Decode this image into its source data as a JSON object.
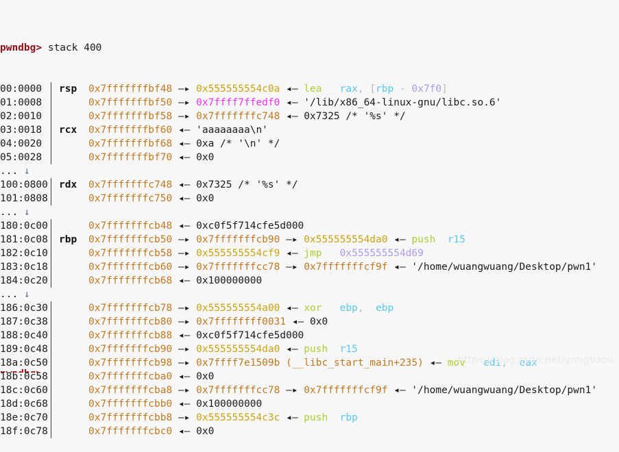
{
  "terminal": {
    "prompt": "pwndbg>",
    "command": "stack 400",
    "watermark": "https://blog.csdn.net/yongbaoii",
    "colors": {
      "background": "#f7f7f7",
      "prompt": "#8b0f18",
      "stack_address": "#c07820",
      "code_address": "#c8a415",
      "libc_address": "#ee33ee",
      "mnemonic": "#a8cf35",
      "register_operand": "#58c8e8",
      "immediate": "#b09ae8",
      "text": "#1a1a1a"
    },
    "arrows": {
      "deref": "—▸",
      "value": "◂—",
      "down": "↓"
    },
    "ellipsis": "...",
    "rows": [
      {
        "index": "00:0000",
        "reg": "rsp",
        "addr": "0x7fffffffbf48",
        "addr_kind": "stack",
        "arrow": "deref",
        "parts": [
          {
            "t": "0x555555554c0a",
            "c": "codeaddr"
          },
          {
            "t": "◂—",
            "c": "arrow"
          },
          {
            "t": "lea",
            "c": "mnemonic"
          },
          {
            "t": "rax",
            "c": "regop"
          },
          {
            "t": ",",
            "c": "punct"
          },
          {
            "t": "[",
            "c": "punct"
          },
          {
            "t": "rbp",
            "c": "regop"
          },
          {
            "t": "-",
            "c": "punct"
          },
          {
            "t": "0x7f0",
            "c": "imm"
          },
          {
            "t": "]",
            "c": "punct"
          }
        ]
      },
      {
        "index": "01:0008",
        "reg": "",
        "addr": "0x7fffffffbf50",
        "addr_kind": "stack",
        "arrow": "deref",
        "parts": [
          {
            "t": "0x7ffff7ffedf0",
            "c": "libcaddr"
          },
          {
            "t": "◂—",
            "c": "arrow"
          },
          {
            "t": "'/lib/x86_64-linux-gnu/libc.so.6'",
            "c": "plain"
          }
        ]
      },
      {
        "index": "02:0010",
        "reg": "",
        "addr": "0x7fffffffbf58",
        "addr_kind": "stack",
        "arrow": "deref",
        "parts": [
          {
            "t": "0x7fffffffc748",
            "c": "stackaddr"
          },
          {
            "t": "◂—",
            "c": "arrow"
          },
          {
            "t": "0x7325 /* '%s' */",
            "c": "plain"
          }
        ]
      },
      {
        "index": "03:0018",
        "reg": "rcx",
        "addr": "0x7fffffffbf60",
        "addr_kind": "stack",
        "arrow": "value",
        "parts": [
          {
            "t": "'aaaaaaaa\\n'",
            "c": "plain"
          }
        ]
      },
      {
        "index": "04:0020",
        "reg": "",
        "addr": "0x7fffffffbf68",
        "addr_kind": "stack",
        "arrow": "value",
        "parts": [
          {
            "t": "0xa /* '\\n' */",
            "c": "plain"
          }
        ]
      },
      {
        "index": "05:0028",
        "reg": "",
        "addr": "0x7fffffffbf70",
        "addr_kind": "stack",
        "arrow": "value",
        "parts": [
          {
            "t": "0x0",
            "c": "plain"
          }
        ]
      },
      {
        "index": "",
        "separator": true
      },
      {
        "index": "100:0800",
        "reg": "rdx",
        "addr": "0x7fffffffc748",
        "addr_kind": "stack",
        "arrow": "value",
        "parts": [
          {
            "t": "0x7325 /* '%s' */",
            "c": "plain"
          }
        ]
      },
      {
        "index": "101:0808",
        "reg": "",
        "addr": "0x7fffffffc750",
        "addr_kind": "stack",
        "arrow": "value",
        "parts": [
          {
            "t": "0x0",
            "c": "plain"
          }
        ]
      },
      {
        "index": "",
        "separator": true
      },
      {
        "index": "180:0c00",
        "reg": "",
        "addr": "0x7fffffffcb48",
        "addr_kind": "stack",
        "arrow": "value",
        "parts": [
          {
            "t": "0xc0f5f714cfe5d000",
            "c": "plain"
          }
        ]
      },
      {
        "index": "181:0c08",
        "reg": "rbp",
        "addr": "0x7fffffffcb50",
        "addr_kind": "stack",
        "arrow": "deref",
        "parts": [
          {
            "t": "0x7fffffffcb90",
            "c": "stackaddr"
          },
          {
            "t": "—▸",
            "c": "arrow"
          },
          {
            "t": "0x555555554da0",
            "c": "codeaddr"
          },
          {
            "t": "◂—",
            "c": "arrow"
          },
          {
            "t": "push",
            "c": "mnemonic"
          },
          {
            "t": "r15",
            "c": "regop"
          }
        ]
      },
      {
        "index": "182:0c10",
        "reg": "",
        "addr": "0x7fffffffcb58",
        "addr_kind": "stack",
        "arrow": "deref",
        "parts": [
          {
            "t": "0x555555554cf9",
            "c": "codeaddr"
          },
          {
            "t": "◂—",
            "c": "arrow"
          },
          {
            "t": "jmp",
            "c": "mnemonic"
          },
          {
            "t": "0x555555554d69",
            "c": "imm"
          }
        ]
      },
      {
        "index": "183:0c18",
        "reg": "",
        "addr": "0x7fffffffcb60",
        "addr_kind": "stack",
        "arrow": "deref",
        "parts": [
          {
            "t": "0x7fffffffcc78",
            "c": "stackaddr"
          },
          {
            "t": "—▸",
            "c": "arrow"
          },
          {
            "t": "0x7fffffffcf9f",
            "c": "stackaddr"
          },
          {
            "t": "◂—",
            "c": "arrow"
          },
          {
            "t": "'/home/wuangwuang/Desktop/pwn1'",
            "c": "plain"
          }
        ]
      },
      {
        "index": "184:0c20",
        "reg": "",
        "addr": "0x7fffffffcb68",
        "addr_kind": "stack",
        "arrow": "value",
        "parts": [
          {
            "t": "0x100000000",
            "c": "plain"
          }
        ]
      },
      {
        "index": "",
        "separator": true
      },
      {
        "index": "186:0c30",
        "reg": "",
        "addr": "0x7fffffffcb78",
        "addr_kind": "stack",
        "arrow": "deref",
        "parts": [
          {
            "t": "0x555555554a00",
            "c": "codeaddr"
          },
          {
            "t": "◂—",
            "c": "arrow"
          },
          {
            "t": "xor",
            "c": "mnemonic"
          },
          {
            "t": "ebp",
            "c": "regop"
          },
          {
            "t": ",",
            "c": "punct"
          },
          {
            "t": "ebp",
            "c": "regop"
          }
        ]
      },
      {
        "index": "187:0c38",
        "reg": "",
        "addr": "0x7fffffffcb80",
        "addr_kind": "stack",
        "arrow": "deref",
        "parts": [
          {
            "t": "0x7ffffffff0031",
            "c": "stackaddr"
          },
          {
            "t": "◂—",
            "c": "arrow"
          },
          {
            "t": "0x0",
            "c": "plain"
          }
        ]
      },
      {
        "index": "188:0c40",
        "reg": "",
        "addr": "0x7fffffffcb88",
        "addr_kind": "stack",
        "arrow": "value",
        "parts": [
          {
            "t": "0xc0f5f714cfe5d000",
            "c": "plain"
          }
        ]
      },
      {
        "index": "189:0c48",
        "reg": "",
        "addr": "0x7fffffffcb90",
        "addr_kind": "stack",
        "arrow": "deref",
        "parts": [
          {
            "t": "0x555555554da0",
            "c": "codeaddr"
          },
          {
            "t": "◂—",
            "c": "arrow"
          },
          {
            "t": "push",
            "c": "mnemonic"
          },
          {
            "t": "r15",
            "c": "regop"
          }
        ]
      },
      {
        "index": "18a:0c50",
        "reg": "",
        "addr": "0x7fffffffcb98",
        "addr_kind": "stack",
        "arrow": "deref",
        "parts": [
          {
            "t": "0x7ffff7e1509b",
            "c": "stackaddr"
          },
          {
            "t": "(__libc_start_main+235)",
            "c": "symbol"
          },
          {
            "t": "◂—",
            "c": "arrow"
          },
          {
            "t": "mov",
            "c": "mnemonic"
          },
          {
            "t": "edi",
            "c": "regop"
          },
          {
            "t": ",",
            "c": "punct"
          },
          {
            "t": "eax",
            "c": "regop"
          }
        ]
      },
      {
        "index": "18b:0c58",
        "reg": "",
        "addr": "0x7fffffffcba0",
        "addr_kind": "stack",
        "arrow": "value",
        "parts": [
          {
            "t": "0x0",
            "c": "plain"
          }
        ]
      },
      {
        "index": "18c:0c60",
        "reg": "",
        "addr": "0x7fffffffcba8",
        "addr_kind": "stack",
        "arrow": "deref",
        "parts": [
          {
            "t": "0x7fffffffcc78",
            "c": "stackaddr"
          },
          {
            "t": "—▸",
            "c": "arrow"
          },
          {
            "t": "0x7fffffffcf9f",
            "c": "stackaddr"
          },
          {
            "t": "◂—",
            "c": "arrow"
          },
          {
            "t": "'/home/wuangwuang/Desktop/pwn1'",
            "c": "plain"
          }
        ]
      },
      {
        "index": "18d:0c68",
        "reg": "",
        "addr": "0x7fffffffcbb0",
        "addr_kind": "stack",
        "arrow": "value",
        "parts": [
          {
            "t": "0x100000000",
            "c": "plain"
          }
        ]
      },
      {
        "index": "18e:0c70",
        "reg": "",
        "addr": "0x7fffffffcbb8",
        "addr_kind": "stack",
        "arrow": "deref",
        "parts": [
          {
            "t": "0x555555554c3c",
            "c": "codeaddr"
          },
          {
            "t": "◂—",
            "c": "arrow"
          },
          {
            "t": "push",
            "c": "mnemonic"
          },
          {
            "t": "rbp",
            "c": "regop"
          }
        ]
      },
      {
        "index": "18f:0c78",
        "reg": "",
        "addr": "0x7fffffffcbc0",
        "addr_kind": "stack",
        "arrow": "value",
        "parts": [
          {
            "t": "0x0",
            "c": "plain"
          }
        ]
      }
    ]
  }
}
